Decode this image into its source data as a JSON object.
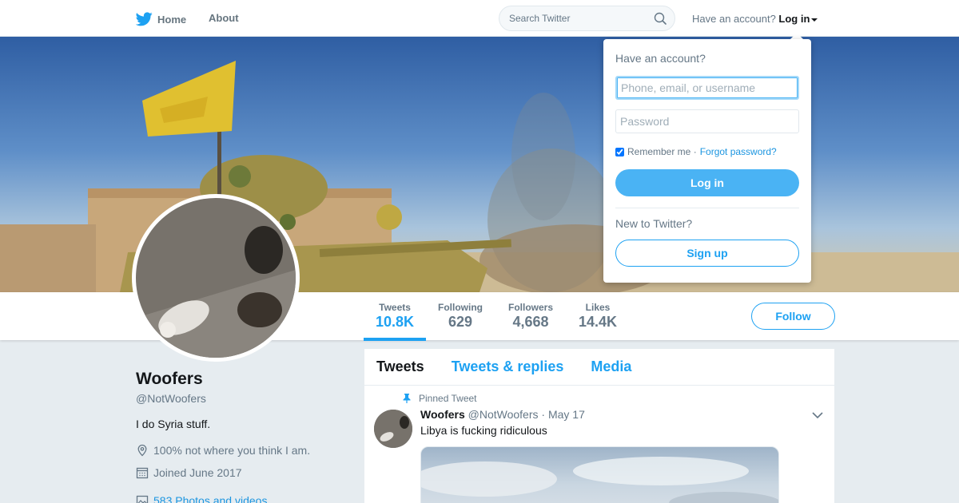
{
  "nav": {
    "home_label": "Home",
    "about_label": "About",
    "search_placeholder": "Search Twitter",
    "account_prompt": "Have an account?",
    "login_label": "Log in"
  },
  "profile": {
    "name": "Woofers",
    "handle": "@NotWoofers",
    "bio": "I do Syria stuff.",
    "location": "100% not where you think I am.",
    "joined": "Joined June 2017",
    "media_link": "583 Photos and videos"
  },
  "stats": [
    {
      "label": "Tweets",
      "value": "10.8K"
    },
    {
      "label": "Following",
      "value": "629"
    },
    {
      "label": "Followers",
      "value": "4,668"
    },
    {
      "label": "Likes",
      "value": "14.4K"
    }
  ],
  "follow_label": "Follow",
  "timeline": {
    "tabs": [
      "Tweets",
      "Tweets & replies",
      "Media"
    ],
    "pinned_label": "Pinned Tweet",
    "tweet": {
      "name": "Woofers",
      "handle": "@NotWoofers",
      "date": "· May 17",
      "text": "Libya is fucking ridiculous"
    }
  },
  "login_dropdown": {
    "title": "Have an account?",
    "username_placeholder": "Phone, email, or username",
    "password_placeholder": "Password",
    "remember_label": "Remember me ·",
    "forgot_label": "Forgot password?",
    "login_button": "Log in",
    "new_prompt": "New to Twitter?",
    "signup_button": "Sign up"
  },
  "colors": {
    "accent": "#1da1f2",
    "login_button": "#4ab3f4",
    "background": "#e6ecf0"
  }
}
